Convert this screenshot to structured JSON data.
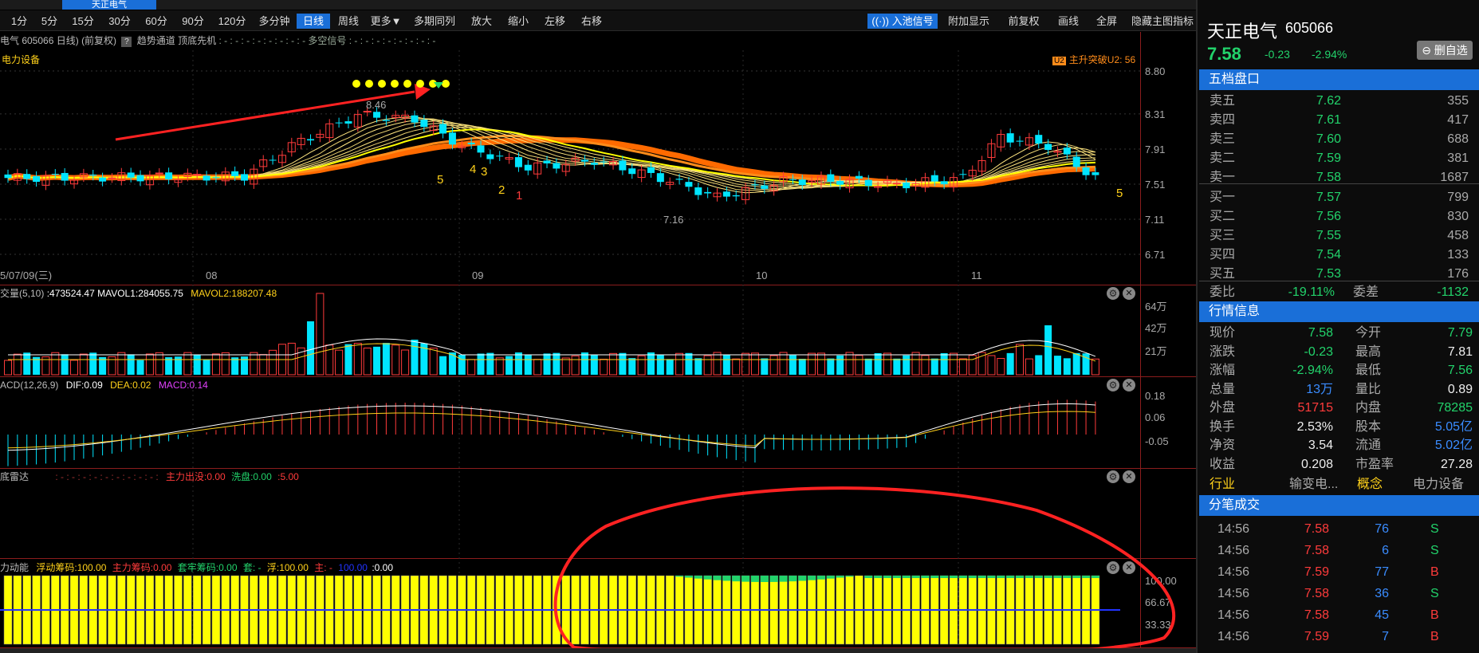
{
  "window": {
    "tab_title": "天正电气"
  },
  "toolbar": {
    "periods": [
      "1分",
      "5分",
      "15分",
      "30分",
      "60分",
      "90分",
      "120分",
      "多分钟",
      "日线",
      "周线",
      "更多▼"
    ],
    "active_period": "日线",
    "tools": [
      "多期同列",
      "放大",
      "缩小",
      "左移",
      "右移"
    ],
    "right": [
      "入池信号",
      "附加显示",
      "前复权",
      "画线",
      "全屏",
      "隐藏主图指标"
    ]
  },
  "chart_header": {
    "title": "电气 605066 日线)",
    "adjust": "(前复权)",
    "help": "?",
    "indicator": "趋势通道 顶底先机",
    "tail": ": - : - : - : - : - : - : - : - 多空信号 : - : - : - : - : - : - : - : -",
    "sector": "电力设备",
    "signal_tag": "U2",
    "signal_text": "主升突破U2: 56"
  },
  "main_chart": {
    "price_ticks": [
      "8.80",
      "8.31",
      "7.91",
      "7.51",
      "7.11",
      "6.71"
    ],
    "date_labels": [
      "5/07/09(三)",
      "08",
      "09",
      "10",
      "11"
    ],
    "high_label": "8.46",
    "low_label": "7.16",
    "wave_marks": [
      "5",
      "4",
      "3",
      "2",
      "1",
      "5"
    ]
  },
  "volume_panel": {
    "title": "交量(5,10)",
    "values_text": ":473524.47 MAVOL1:284055.75",
    "mavol2": "MAVOL2:188207.48",
    "ticks": [
      "64万",
      "42万",
      "21万"
    ]
  },
  "macd_panel": {
    "title": "ACD(12,26,9)",
    "dif": "DIF:0.09",
    "dea": "DEA:0.02",
    "macd": "MACD:0.14",
    "ticks": [
      "0.18",
      "0.06",
      "-0.05"
    ]
  },
  "radar_panel": {
    "title": "底雷达",
    "mid": ": - : - : - : - : - : - : - : - : - :",
    "main_out": "主力出没:0.00",
    "wash": "洗盘:0.00",
    "last": ":5.00"
  },
  "momentum_panel": {
    "title": "力动能",
    "float": "浮动筹码:100.00",
    "main": "主力筹码:0.00",
    "trap": "套牢筹码:0.00",
    "trap_short": "套: -",
    "float2": "浮:100.00",
    "main_short": "主: -",
    "blue_val": "100.00",
    "last": ":0.00",
    "ticks": [
      "100.00",
      "66.67",
      "33.33"
    ]
  },
  "quote": {
    "name": "天正电气",
    "code": "605066",
    "price": "7.58",
    "change": "-0.23",
    "change_pct": "-2.94%",
    "del_fav": "⊖ 删自选"
  },
  "order_book": {
    "title": "五档盘口",
    "asks": [
      {
        "label": "卖五",
        "price": "7.62",
        "vol": "355"
      },
      {
        "label": "卖四",
        "price": "7.61",
        "vol": "417"
      },
      {
        "label": "卖三",
        "price": "7.60",
        "vol": "688"
      },
      {
        "label": "卖二",
        "price": "7.59",
        "vol": "381"
      },
      {
        "label": "卖一",
        "price": "7.58",
        "vol": "1687"
      }
    ],
    "bids": [
      {
        "label": "买一",
        "price": "7.57",
        "vol": "799"
      },
      {
        "label": "买二",
        "price": "7.56",
        "vol": "830"
      },
      {
        "label": "买三",
        "price": "7.55",
        "vol": "458"
      },
      {
        "label": "买四",
        "price": "7.54",
        "vol": "133"
      },
      {
        "label": "买五",
        "price": "7.53",
        "vol": "176"
      }
    ],
    "wei_bi_label": "委比",
    "wei_bi": "-19.11%",
    "wei_cha_label": "委差",
    "wei_cha": "-1132"
  },
  "market_info": {
    "title": "行情信息",
    "rows": [
      {
        "l1": "现价",
        "v1": "7.58",
        "c1": "green",
        "l2": "今开",
        "v2": "7.79",
        "c2": "green"
      },
      {
        "l1": "涨跌",
        "v1": "-0.23",
        "c1": "green",
        "l2": "最高",
        "v2": "7.81",
        "c2": "white"
      },
      {
        "l1": "涨幅",
        "v1": "-2.94%",
        "c1": "green",
        "l2": "最低",
        "v2": "7.56",
        "c2": "green"
      },
      {
        "l1": "总量",
        "v1": "13万",
        "c1": "blue",
        "l2": "量比",
        "v2": "0.89",
        "c2": "white"
      },
      {
        "l1": "外盘",
        "v1": "51715",
        "c1": "red",
        "l2": "内盘",
        "v2": "78285",
        "c2": "green"
      },
      {
        "l1": "换手",
        "v1": "2.53%",
        "c1": "white",
        "l2": "股本",
        "v2": "5.05亿",
        "c2": "blue"
      },
      {
        "l1": "净资",
        "v1": "3.54",
        "c1": "white",
        "l2": "流通",
        "v2": "5.02亿",
        "c2": "blue"
      },
      {
        "l1": "收益",
        "v1": "0.208",
        "c1": "white",
        "l2": "市盈率",
        "v2": "27.28",
        "c2": "white"
      }
    ],
    "industry_label": "行业",
    "industry": "输变电...",
    "concept_label": "概念",
    "concept": "电力设备"
  },
  "ticks_panel": {
    "title": "分笔成交",
    "rows": [
      {
        "time": "14:56",
        "price": "7.58",
        "vol": "76",
        "side": "S"
      },
      {
        "time": "14:56",
        "price": "7.58",
        "vol": "6",
        "side": "S"
      },
      {
        "time": "14:56",
        "price": "7.59",
        "vol": "77",
        "side": "B"
      },
      {
        "time": "14:56",
        "price": "7.58",
        "vol": "36",
        "side": "S"
      },
      {
        "time": "14:56",
        "price": "7.58",
        "vol": "45",
        "side": "B"
      },
      {
        "time": "14:56",
        "price": "7.59",
        "vol": "7",
        "side": "B"
      }
    ]
  },
  "colors": {
    "up": "#ff3b3b",
    "down": "#00e5ff",
    "accent": "#1a6fd8",
    "green": "#22d36b",
    "yellow": "#ffff00"
  }
}
